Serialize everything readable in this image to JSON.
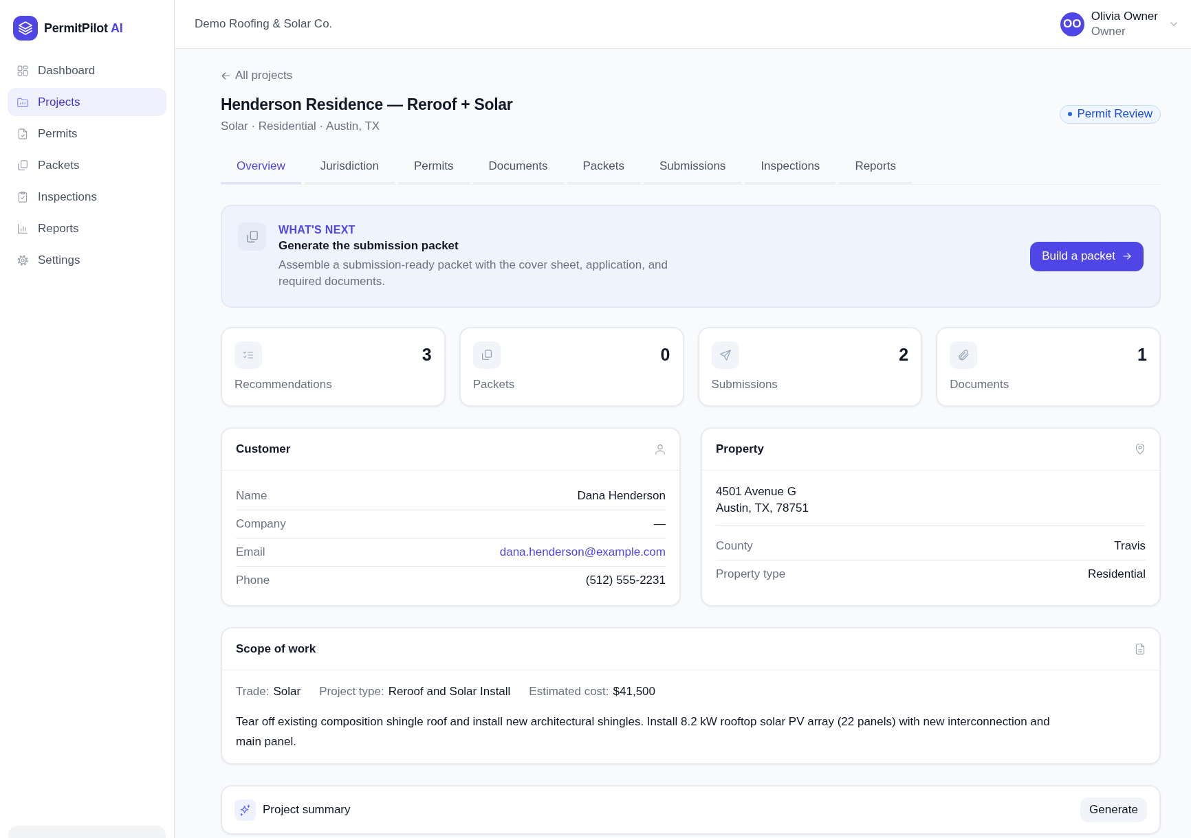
{
  "sidebar": {
    "brand": {
      "name": "PermitPilot",
      "suffix": "AI"
    },
    "items": [
      {
        "label": "Dashboard",
        "selected": false
      },
      {
        "label": "Projects",
        "selected": true
      },
      {
        "label": "Permits",
        "selected": false
      },
      {
        "label": "Packets",
        "selected": false
      },
      {
        "label": "Inspections",
        "selected": false
      },
      {
        "label": "Reports",
        "selected": false
      },
      {
        "label": "Settings",
        "selected": false
      }
    ]
  },
  "header": {
    "company": "Demo Roofing & Solar Co.",
    "user": {
      "initials": "OO",
      "name": "Olivia Owner",
      "role": "Owner"
    }
  },
  "breadcrumb": {
    "label": "All projects"
  },
  "project": {
    "title": "Henderson Residence — Reroof + Solar",
    "subtitle": "Solar · Residential · Austin, TX",
    "status": "Permit Review"
  },
  "tabs": [
    {
      "label": "Overview",
      "selected": true
    },
    {
      "label": "Jurisdiction",
      "selected": false
    },
    {
      "label": "Permits",
      "selected": false
    },
    {
      "label": "Documents",
      "selected": false
    },
    {
      "label": "Packets",
      "selected": false
    },
    {
      "label": "Submissions",
      "selected": false
    },
    {
      "label": "Inspections",
      "selected": false
    },
    {
      "label": "Reports",
      "selected": false
    }
  ],
  "next_step": {
    "eyebrow": "WHAT'S NEXT",
    "title": "Generate the submission packet",
    "description": "Assemble a submission-ready packet with the cover sheet, application, and required documents.",
    "action": "Build a packet"
  },
  "stats": [
    {
      "value": "3",
      "label": "Recommendations"
    },
    {
      "value": "0",
      "label": "Packets"
    },
    {
      "value": "2",
      "label": "Submissions"
    },
    {
      "value": "1",
      "label": "Documents"
    }
  ],
  "customer": {
    "title": "Customer",
    "fields": [
      {
        "label": "Name",
        "value": "Dana Henderson",
        "kind": "text"
      },
      {
        "label": "Company",
        "value": "—",
        "kind": "text"
      },
      {
        "label": "Email",
        "value": "dana.henderson@example.com",
        "kind": "link"
      },
      {
        "label": "Phone",
        "value": "(512) 555-2231",
        "kind": "text"
      }
    ]
  },
  "property": {
    "title": "Property",
    "address": [
      "4501 Avenue G",
      "Austin, TX, 78751"
    ],
    "fields": [
      {
        "label": "County",
        "value": "Travis"
      },
      {
        "label": "Property type",
        "value": "Residential"
      }
    ]
  },
  "scope": {
    "title": "Scope of work",
    "facts": [
      {
        "label": "Trade:",
        "value": "Solar"
      },
      {
        "label": "Project type:",
        "value": "Reroof and Solar Install"
      },
      {
        "label": "Estimated cost:",
        "value": "$41,500"
      }
    ],
    "description": "Tear off existing composition shingle roof and install new architectural shingles. Install 8.2 kW rooftop solar PV array (22 panels) with new interconnection and main panel."
  },
  "summary": {
    "title": "Project summary",
    "action": "Generate"
  }
}
